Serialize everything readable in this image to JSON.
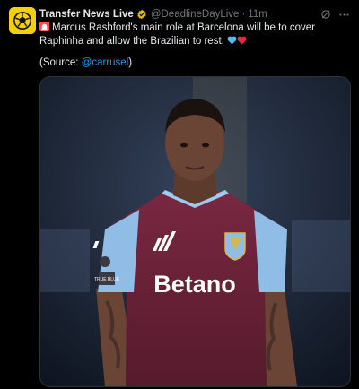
{
  "tweet": {
    "display_name": "Transfer News Live",
    "handle": "@DeadlineDayLive",
    "separator": "·",
    "time": "11m",
    "text": "Marcus Rashford's main role at Barcelona will be to cover Raphinha and allow the Brazilian to rest.",
    "source_prefix": "(Source: ",
    "source_mention": "@carrusel",
    "source_suffix": ")",
    "image": {
      "sponsor_text": "Betano",
      "sleeve_badge_text": "TRUE\nBLUE"
    }
  },
  "colors": {
    "accent": "#1d9bf0",
    "verified_gold": "#e2b719",
    "avatar_bg": "#f5d000",
    "shirt_claret": "#6b2238",
    "shirt_sky": "#8fbde6"
  },
  "icons": {
    "avatar": "soccer-ball-logo",
    "verified": "verified-badge-icon",
    "grok": "grok-icon",
    "more": "more-icon",
    "siren": "siren-emoji",
    "blue_heart": "blue-heart-emoji",
    "red_heart": "red-heart-emoji"
  }
}
